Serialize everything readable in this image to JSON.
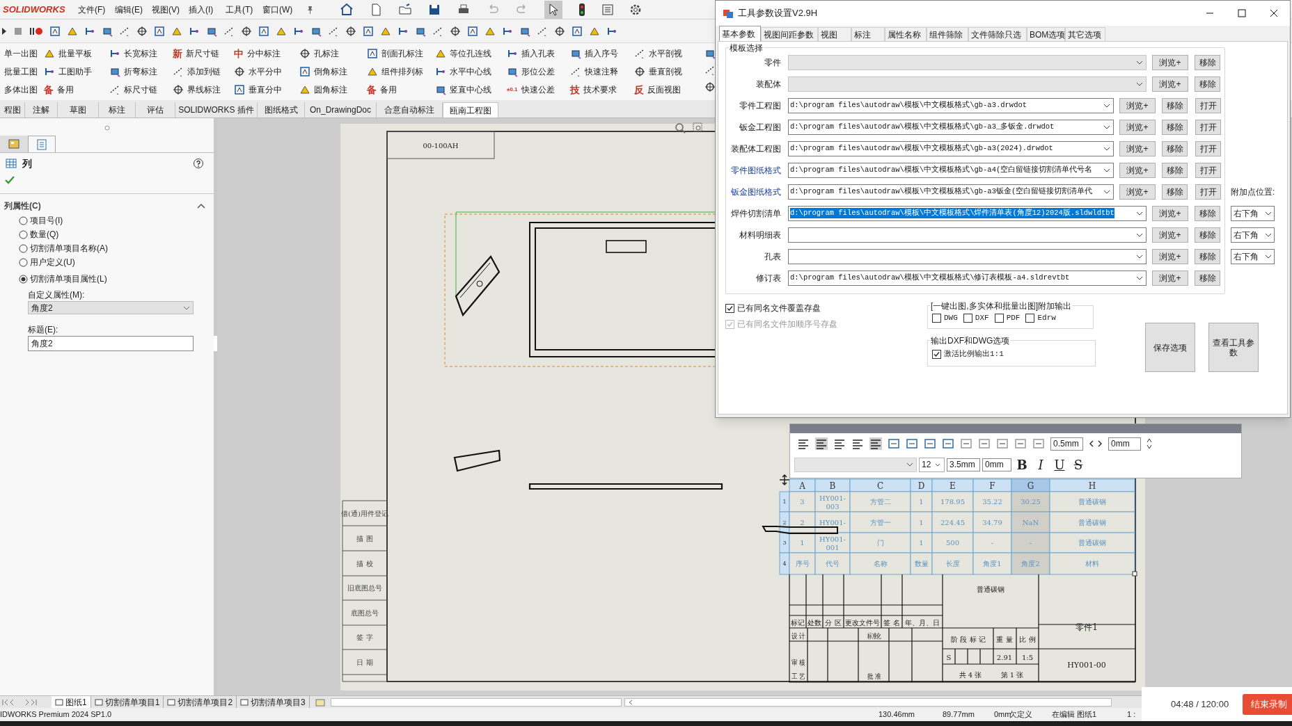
{
  "menubar": {
    "logo": "SOLIDWORKS",
    "menus": [
      "文件(F)",
      "编辑(E)",
      "视图(V)",
      "插入(I)",
      "工具(T)",
      "窗口(W)"
    ]
  },
  "command_manager": {
    "columns": [
      [
        {
          "label": "单一出图"
        },
        {
          "label": "批量工图"
        },
        {
          "label": "多体出图"
        }
      ],
      [
        {
          "label": "批量平板"
        },
        {
          "label": "工图助手"
        },
        {
          "label": "备用",
          "glyph": "备"
        }
      ],
      [
        {
          "label": "长宽标注"
        },
        {
          "label": "折弯标注"
        },
        {
          "label": "标尺寸链"
        }
      ],
      [
        {
          "label": "新尺寸链",
          "glyph": "新"
        },
        {
          "label": "添加到链"
        },
        {
          "label": "界线标注"
        }
      ],
      [
        {
          "label": "分中标注",
          "glyph": "中"
        },
        {
          "label": "水平分中"
        },
        {
          "label": "垂直分中"
        }
      ],
      [
        {
          "label": "孔标注"
        },
        {
          "label": "倒角标注"
        },
        {
          "label": "圆角标注"
        }
      ],
      [
        {
          "label": "剖面孔标注"
        },
        {
          "label": "组件排列标"
        },
        {
          "label": "备用",
          "glyph": "备"
        }
      ],
      [
        {
          "label": "等位孔连线"
        },
        {
          "label": "水平中心线"
        },
        {
          "label": "竖直中心线"
        }
      ],
      [
        {
          "label": "插入孔表"
        },
        {
          "label": "形位公差"
        },
        {
          "label": "快速公差",
          "glyph": "±0.1"
        }
      ],
      [
        {
          "label": "插入序号"
        },
        {
          "label": "快速注释"
        },
        {
          "label": "技术要求",
          "glyph": "技"
        }
      ],
      [
        {
          "label": "水平剖视"
        },
        {
          "label": "垂直剖视"
        },
        {
          "label": "反面视图",
          "glyph": "反"
        }
      ]
    ]
  },
  "ribbon_tabs": [
    {
      "label": "程图",
      "selected": false
    },
    {
      "label": "注解",
      "selected": false
    },
    {
      "label": "草图",
      "selected": false
    },
    {
      "label": "标注",
      "selected": false
    },
    {
      "label": "评估",
      "selected": false
    },
    {
      "label": "SOLIDWORKS 插件",
      "selected": false
    },
    {
      "label": "图纸格式",
      "selected": false
    },
    {
      "label": "On_DrawingDoc",
      "selected": false
    },
    {
      "label": "合意自动标注",
      "selected": false
    },
    {
      "label": "瓯南工程图",
      "selected": true
    }
  ],
  "property_manager": {
    "panel_tabs": [
      {
        "selected": false
      },
      {
        "selected": true
      }
    ],
    "title": "列",
    "section": "列属性(C)",
    "expanded": true,
    "options": [
      {
        "label": "项目号(I)",
        "selected": false
      },
      {
        "label": "数量(Q)",
        "selected": false
      },
      {
        "label": "切割清单项目名称(A)",
        "selected": false
      },
      {
        "label": "用户定义(U)",
        "selected": false
      },
      {
        "label": "切割清单项目属性(L)",
        "selected": true
      }
    ],
    "custom_property_label": "自定义属性(M):",
    "custom_property_value": "角度2",
    "caption_label": "标题(E):",
    "caption_value": "角度2"
  },
  "drawing": {
    "sheet_code": "00-100AH",
    "margin_labels": [
      "借(通)用件登记",
      "描 图",
      "描 校",
      "旧底图总号",
      "底图总号",
      "签 字",
      "日 期"
    ],
    "table": {
      "columns": [
        {
          "label": "A",
          "selected": false
        },
        {
          "label": "B",
          "selected": false
        },
        {
          "label": "C",
          "selected": false
        },
        {
          "label": "D",
          "selected": false
        },
        {
          "label": "E",
          "selected": false
        },
        {
          "label": "F",
          "selected": false
        },
        {
          "label": "G",
          "selected": true
        },
        {
          "label": "H",
          "selected": false
        }
      ],
      "row_numbers": [
        "1",
        "2",
        "3",
        "4"
      ],
      "rows": [
        [
          "3",
          "HY001-003",
          "方管二",
          "1",
          "178.95",
          "35.22",
          "30.25",
          "普通碳钢"
        ],
        [
          "2",
          "HY001-",
          "方管一",
          "1",
          "224.45",
          "34.79",
          "NaN",
          "普通碳钢"
        ],
        [
          "1",
          "HY001-001",
          "门",
          "1",
          "500",
          "-",
          "-",
          "普通碳钢"
        ],
        [
          "序号",
          "代号",
          "名称",
          "数量",
          "长度",
          "角度1",
          "角度2",
          "材料"
        ]
      ]
    },
    "title_block": {
      "header_labels": [
        "标记",
        "处数",
        "分 区",
        "更改文件号",
        "签 名",
        "年、月、日"
      ],
      "side_labels": [
        "设 计",
        "标准化",
        "审 核",
        "工 艺",
        "批 准"
      ],
      "stage_labels": [
        "阶 段 标 记",
        "重 量",
        "比 例"
      ],
      "material": "普通碳钢",
      "stage": "S",
      "weight": "2.91",
      "scale": "1:5",
      "sheets_total": "共 4 张",
      "sheet_no": "第 1 张",
      "part_name": "零件1",
      "drawing_number": "HY001-00"
    }
  },
  "table_editor": {
    "gap_fields": [
      "0.5mm",
      "0mm"
    ],
    "font_size": "12",
    "text_height": "3.5mm",
    "spacing": "0mm",
    "style_buttons": [
      {
        "label": "B",
        "kind": "bold"
      },
      {
        "label": "I",
        "kind": "italic"
      },
      {
        "label": "U",
        "kind": "underline"
      },
      {
        "label": "S",
        "kind": "strike"
      }
    ]
  },
  "sheet_tabs": [
    {
      "label": "图纸1",
      "selected": true
    },
    {
      "label": "切割清单项目1",
      "selected": false
    },
    {
      "label": "切割清单项目2",
      "selected": false
    },
    {
      "label": "切割清单项目3",
      "selected": false
    }
  ],
  "status_bar": {
    "product": "IDWORKS Premium 2024 SP1.0",
    "x": "130.46mm",
    "y": "89.77mm",
    "z": "0mm",
    "state": "欠定义",
    "mode": "在编辑 图纸1",
    "scale": "1 :"
  },
  "dialog": {
    "title": "工具参数设置V2.9H",
    "tabs": [
      {
        "label": "基本参数",
        "selected": true
      },
      {
        "label": "视图间距参数",
        "selected": false
      },
      {
        "label": "视图",
        "selected": false
      },
      {
        "label": "标注",
        "selected": false
      },
      {
        "label": "属性名称",
        "selected": false
      },
      {
        "label": "组件筛除",
        "selected": false
      },
      {
        "label": "文件筛除只选",
        "selected": false
      },
      {
        "label": "BOM选项",
        "selected": false
      },
      {
        "label": "其它选项",
        "selected": false
      }
    ],
    "group": "模板选择",
    "rows": [
      {
        "label": "零件",
        "kind": "list",
        "emphasized": false,
        "buttons": [
          "浏览+",
          "移除"
        ]
      },
      {
        "label": "装配体",
        "kind": "list",
        "emphasized": false,
        "buttons": [
          "浏览+",
          "移除"
        ]
      },
      {
        "label": "零件工程图",
        "kind": "edit",
        "value": "d:\\program files\\autodraw\\模板\\中文模板格式\\gb-a3.drwdot",
        "emphasized": false,
        "text_selected": false,
        "buttons": [
          "浏览+",
          "移除",
          "打开"
        ]
      },
      {
        "label": "钣金工程图",
        "kind": "edit",
        "value": "d:\\program files\\autodraw\\模板\\中文模板格式\\gb-a3_多钣金.drwdot",
        "emphasized": false,
        "text_selected": false,
        "buttons": [
          "浏览+",
          "移除",
          "打开"
        ]
      },
      {
        "label": "装配体工程图",
        "kind": "edit",
        "value": "d:\\program files\\autodraw\\模板\\中文模板格式\\gb-a3(2024).drwdot",
        "emphasized": false,
        "text_selected": false,
        "buttons": [
          "浏览+",
          "移除",
          "打开"
        ]
      },
      {
        "label": "零件图纸格式",
        "kind": "edit",
        "value": "d:\\program files\\autodraw\\模板\\中文模板格式\\gb-a4(空白留链接切割清单代号名",
        "emphasized": true,
        "text_selected": false,
        "buttons": [
          "浏览+",
          "移除",
          "打开"
        ]
      },
      {
        "label": "钣金图纸格式",
        "kind": "edit",
        "value": "d:\\program files\\autodraw\\模板\\中文模板格式\\gb-a3钣金(空白留链接切割清单代",
        "emphasized": true,
        "text_selected": false,
        "buttons": [
          "浏览+",
          "移除",
          "打开"
        ],
        "side_label": "附加点位置:"
      },
      {
        "label": "焊件切割清单",
        "kind": "edit",
        "value": "d:\\program files\\autodraw\\模板\\中文模板格式\\焊件清单表(角度12)2024版.sldwldtbt",
        "emphasized": false,
        "text_selected": true,
        "buttons": [
          "浏览+",
          "移除"
        ],
        "position": "右下角"
      },
      {
        "label": "材料明细表",
        "kind": "edit",
        "emphasized": false,
        "buttons": [
          "浏览+",
          "移除"
        ],
        "position": "右下角"
      },
      {
        "label": "孔表",
        "kind": "edit",
        "emphasized": false,
        "buttons": [
          "浏览+",
          "移除"
        ],
        "position": "右下角"
      },
      {
        "label": "修订表",
        "kind": "edit",
        "value": "d:\\program files\\autodraw\\模板\\中文模板格式\\修订表模板-a4.sldrevtbt",
        "emphasized": false,
        "text_selected": false,
        "buttons": [
          "浏览+",
          "移除"
        ]
      }
    ],
    "options": [
      {
        "label": "已有同名文件覆盖存盘",
        "checked": true,
        "disabled": false
      },
      {
        "label": "已有同名文件加顺序号存盘",
        "checked": true,
        "disabled": true
      }
    ],
    "output_group": {
      "title": "[一键出图,多实体和批量出图]附加输出",
      "items": [
        {
          "label": "DWG",
          "checked": false
        },
        {
          "label": "DXF",
          "checked": false
        },
        {
          "label": "PDF",
          "checked": false
        },
        {
          "label": "Edrw",
          "checked": false
        }
      ]
    },
    "dxf_group": {
      "title": "输出DXF和DWG选项",
      "items": [
        {
          "label": "激活比例输出1:1",
          "checked": true
        }
      ]
    },
    "buttons": [
      "保存选项",
      "查看工具参数"
    ]
  },
  "recorder": {
    "time": "04:48 / 120:00",
    "stop_button": "结束录制"
  }
}
